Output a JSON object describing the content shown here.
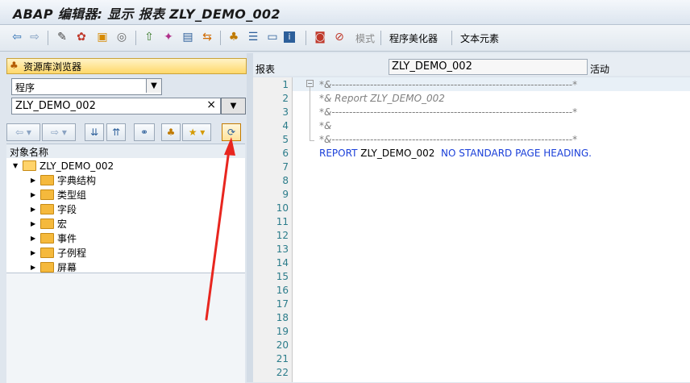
{
  "window": {
    "title": "ABAP 编辑器: 显示 报表 ZLY_DEMO_002"
  },
  "toolbar": {
    "icons": [
      "back-icon",
      "forward-icon",
      "glasses-icon",
      "objects-icon",
      "hierarchy-icon",
      "where-used-icon",
      "upload-icon",
      "wand-icon",
      "debug-icon",
      "display-icon",
      "layout-icon",
      "list-icon",
      "info-icon",
      "breakpoint-icon",
      "stop-icon"
    ],
    "mode_label": "模式",
    "pretty_printer_label": "程序美化器",
    "text_elements_label": "文本元素"
  },
  "left": {
    "repository_browser_label": "资源库浏览器",
    "object_type_value": "程序",
    "object_name_value": "ZLY_DEMO_002",
    "clear_symbol": "×",
    "tree_header": "对象名称",
    "tree": {
      "root": "ZLY_DEMO_002",
      "children": [
        "字典结构",
        "类型组",
        "字段",
        "宏",
        "事件",
        "子例程",
        "屏幕"
      ]
    }
  },
  "right": {
    "type_label": "报表",
    "program_name": "ZLY_DEMO_002",
    "status_label": "活动",
    "line_numbers": [
      "1",
      "2",
      "3",
      "4",
      "5",
      "6",
      "7",
      "8",
      "9",
      "10",
      "11",
      "12",
      "13",
      "14",
      "15",
      "16",
      "17",
      "18",
      "19",
      "20",
      "21",
      "22"
    ],
    "code": {
      "line1": "*&---------------------------------------------------------------------*",
      "line2": "*& Report ZLY_DEMO_002",
      "line3": "*&---------------------------------------------------------------------*",
      "line4": "*&",
      "line5": "*&---------------------------------------------------------------------*",
      "line6_kw1": "REPORT",
      "line6_name": " ZLY_DEMO_002 ",
      "line6_kw2": " NO STANDARD PAGE HEADING."
    }
  },
  "colors": {
    "annotation_arrow": "#e8261f",
    "keyword": "#1a3fd9",
    "comment": "#808080",
    "line_number": "#2b7c8a"
  }
}
